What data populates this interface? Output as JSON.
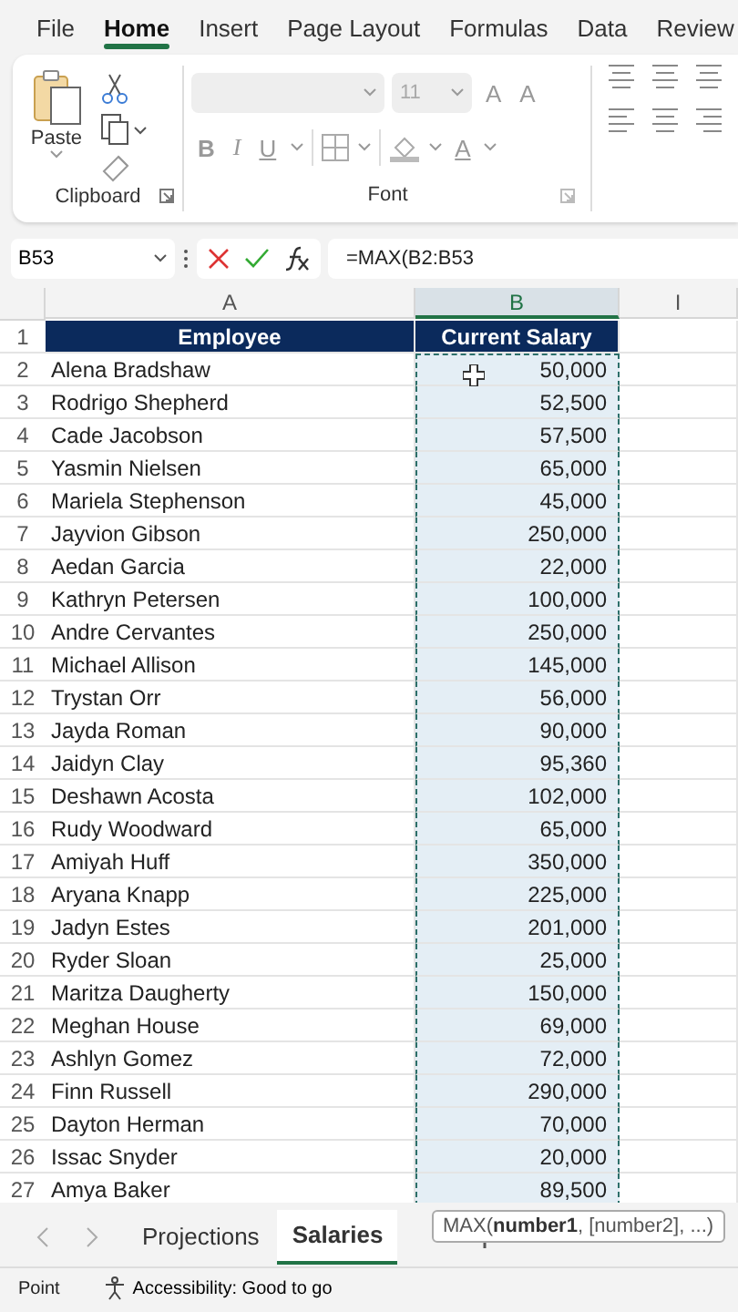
{
  "menu_tabs": [
    {
      "label": "File",
      "selected": false
    },
    {
      "label": "Home",
      "selected": true
    },
    {
      "label": "Insert",
      "selected": false
    },
    {
      "label": "Page Layout",
      "selected": false
    },
    {
      "label": "Formulas",
      "selected": false
    },
    {
      "label": "Data",
      "selected": false
    },
    {
      "label": "Review",
      "selected": false
    }
  ],
  "ribbon": {
    "clipboard": {
      "paste": "Paste",
      "group_label": "Clipboard"
    },
    "font": {
      "size": "11",
      "grow": "A",
      "shrink": "A",
      "bold": "B",
      "italic": "I",
      "underline": "U",
      "font_color": "A",
      "group_label": "Font"
    }
  },
  "formula_bar": {
    "name_box": "B53",
    "formula": "=MAX(B2:B53"
  },
  "sheet": {
    "columns": [
      {
        "label": "A",
        "selected": false
      },
      {
        "label": "B",
        "selected": true
      },
      {
        "label": "I",
        "selected": false
      }
    ],
    "header": {
      "num": "1",
      "cells": [
        "Employee",
        "Current Salary"
      ]
    },
    "rows": [
      {
        "num": "2",
        "name": "Alena Bradshaw",
        "salary": "50,000",
        "in_range": true
      },
      {
        "num": "3",
        "name": "Rodrigo Shepherd",
        "salary": "52,500",
        "in_range": true
      },
      {
        "num": "4",
        "name": "Cade Jacobson",
        "salary": "57,500",
        "in_range": true
      },
      {
        "num": "5",
        "name": "Yasmin Nielsen",
        "salary": "65,000",
        "in_range": true
      },
      {
        "num": "6",
        "name": "Mariela Stephenson",
        "salary": "45,000",
        "in_range": true
      },
      {
        "num": "7",
        "name": "Jayvion Gibson",
        "salary": "250,000",
        "in_range": true
      },
      {
        "num": "8",
        "name": "Aedan Garcia",
        "salary": "22,000",
        "in_range": true
      },
      {
        "num": "9",
        "name": "Kathryn Petersen",
        "salary": "100,000",
        "in_range": true
      },
      {
        "num": "10",
        "name": "Andre Cervantes",
        "salary": "250,000",
        "in_range": true
      },
      {
        "num": "11",
        "name": "Michael Allison",
        "salary": "145,000",
        "in_range": true
      },
      {
        "num": "12",
        "name": "Trystan Orr",
        "salary": "56,000",
        "in_range": true
      },
      {
        "num": "13",
        "name": "Jayda Roman",
        "salary": "90,000",
        "in_range": true
      },
      {
        "num": "14",
        "name": "Jaidyn Clay",
        "salary": "95,360",
        "in_range": true
      },
      {
        "num": "15",
        "name": "Deshawn Acosta",
        "salary": "102,000",
        "in_range": true
      },
      {
        "num": "16",
        "name": "Rudy Woodward",
        "salary": "65,000",
        "in_range": true
      },
      {
        "num": "17",
        "name": "Amiyah Huff",
        "salary": "350,000",
        "in_range": true
      },
      {
        "num": "18",
        "name": "Aryana Knapp",
        "salary": "225,000",
        "in_range": true
      },
      {
        "num": "19",
        "name": "Jadyn Estes",
        "salary": "201,000",
        "in_range": true
      },
      {
        "num": "20",
        "name": "Ryder Sloan",
        "salary": "25,000",
        "in_range": true
      },
      {
        "num": "21",
        "name": "Maritza Daugherty",
        "salary": "150,000",
        "in_range": true
      },
      {
        "num": "22",
        "name": "Meghan House",
        "salary": "69,000",
        "in_range": true
      },
      {
        "num": "23",
        "name": "Ashlyn Gomez",
        "salary": "72,000",
        "in_range": true
      },
      {
        "num": "24",
        "name": "Finn Russell",
        "salary": "290,000",
        "in_range": true
      },
      {
        "num": "25",
        "name": "Dayton Herman",
        "salary": "70,000",
        "in_range": true
      },
      {
        "num": "26",
        "name": "Issac Snyder",
        "salary": "20,000",
        "in_range": true
      },
      {
        "num": "27",
        "name": "Amya Baker",
        "salary": "89,500",
        "in_range": true
      }
    ]
  },
  "tooltip": "MAX(**number1**, [number2], ...)",
  "sheet_tabs": [
    {
      "label": "Projections",
      "selected": false
    },
    {
      "label": "Salaries",
      "selected": true
    }
  ],
  "status_bar": {
    "mode": "Point",
    "accessibility": "Accessibility: Good to go"
  }
}
